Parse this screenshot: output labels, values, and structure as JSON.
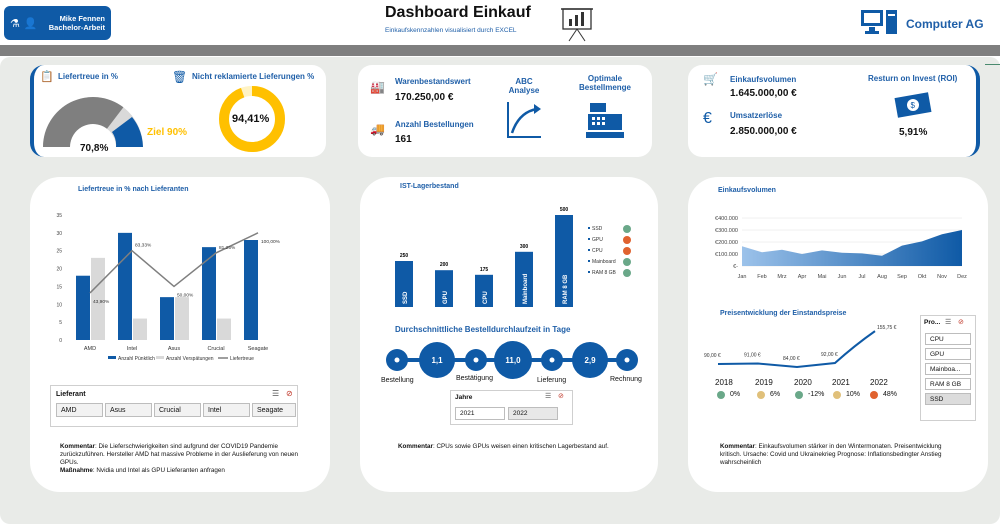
{
  "header": {
    "user_name": "Mike Fennen",
    "user_role": "Bachelor-Arbeit",
    "title": "Dashboard Einkauf",
    "subtitle": "Einkaufskennzahlen visualisiert durch EXCEL",
    "company": "Computer AG"
  },
  "kpi_left": {
    "liefertreue_label": "Liefertreue in %",
    "liefertreue_value": "70,8%",
    "liefertreue_fraction": 0.708,
    "ziel_label": "Ziel 90%",
    "reklam_label": "Nicht reklamierte Lieferungen %",
    "reklam_value": "94,41%",
    "reklam_fraction": 0.9441
  },
  "kpi_mid": {
    "lager_label": "Warenbestandswert",
    "lager_value": "170.250,00 €",
    "bestell_label": "Anzahl Bestellungen",
    "bestell_value": "161",
    "abc_label": "ABC Analyse",
    "opt_label": "Optimale Bestellmenge"
  },
  "kpi_right": {
    "volumen_label": "Einkaufsvolumen",
    "volumen_value": "1.645.000,00 €",
    "umsatz_label": "Umsatzerlöse",
    "umsatz_value": "2.850.000,00 €",
    "roi_label": "Resturn on Invest (ROI)",
    "roi_value": "5,91%"
  },
  "panel_left": {
    "title": "Liefertreue in % nach  Lieferanten",
    "slicer_title": "Lieferant",
    "slicer_items": [
      "AMD",
      "Asus",
      "Crucial",
      "Intel",
      "Seagate"
    ],
    "comment_k_label": "Kommentar",
    "comment_k": ": Die Lieferschwierigkeiten sind aufgrund der COVID19 Pandemie zurückzuführen. Hersteller AMD hat massive Probleme in der Auslieferung von neuen GPUs.",
    "comment_m_label": "Maßnahme",
    "comment_m": ": Nvidia und Intel als GPU Lieferanten anfragen"
  },
  "panel_mid": {
    "title": "IST-Lagerbestand",
    "lead_title": "Durchschnittliche Bestelldurchlaufzeit in Tage",
    "steps": [
      "Bestellung",
      "Bestätigung",
      "Lieferung",
      "Rechnung"
    ],
    "durations": [
      "1,1",
      "11,0",
      "2,9"
    ],
    "slicer_title": "Jahre",
    "slicer_items": [
      "2021",
      "2022"
    ],
    "comment_label": "Kommentar",
    "comment": ": CPUs sowie GPUs weisen einen kritischen Lagerbestand auf."
  },
  "panel_right": {
    "title": "Einkaufsvolumen",
    "price_title": "Preisentwicklung der Einstandspreise",
    "price_years": [
      "2018",
      "2019",
      "2020",
      "2021",
      "2022"
    ],
    "price_changes": [
      "0%",
      "6%",
      "-12%",
      "10%",
      "48%"
    ],
    "price_dot_colors": [
      "#6aa889",
      "#e0c07a",
      "#6aa889",
      "#e0c07a",
      "#e0622f"
    ],
    "slicer_title": "Pro...",
    "slicer_items": [
      "CPU",
      "GPU",
      "Mainboa...",
      "RAM 8 GB",
      "SSD"
    ],
    "comment_label": "Kommentar",
    "comment": ": Einkaufsvolumen stärker in den Wintermonaten. Preisentwicklung kritisch. Ursache: Covid und Ukrainekrieg Prognose: Inflationsbedingter Anstieg wahrscheinlich"
  },
  "colors": {
    "brand_blue": "#0f5aa6",
    "bar_grey": "#d9d9d9",
    "line_grey": "#7f7f7f",
    "donut_yellow": "#ffc000",
    "status_green": "#6aa889",
    "status_red": "#e0622f",
    "status_orange": "#e0c07a"
  },
  "chart_data": [
    {
      "type": "bar",
      "title": "Liefertreue in % nach  Lieferanten",
      "categories": [
        "AMD",
        "Intel",
        "Asus",
        "Crucial",
        "Seagate"
      ],
      "ylim": [
        0,
        35
      ],
      "yticks": [
        "0",
        "5",
        "10",
        "15",
        "20",
        "25",
        "30",
        "35"
      ],
      "series": [
        {
          "name": "Anzahl Pünktlich",
          "values": [
            18,
            30,
            12,
            26,
            28
          ]
        },
        {
          "name": "Anzahl Verspätungen",
          "values": [
            23,
            6,
            12,
            6,
            0
          ]
        }
      ],
      "line_series": {
        "name": "Liefertreue",
        "labels": [
          "43,90%",
          "83,33%",
          "50,00%",
          "81,25%",
          "100,00%"
        ],
        "values": [
          43.9,
          83.33,
          50.0,
          81.25,
          100.0
        ]
      },
      "legend_placement": "bottom"
    },
    {
      "type": "bar",
      "title": "IST-Lagerbestand",
      "categories": [
        "SSD",
        "GPU",
        "CPU",
        "Mainboard",
        "RAM 8 GB"
      ],
      "values": [
        250,
        200,
        175,
        300,
        500
      ],
      "value_labels": [
        "250",
        "200",
        "175",
        "300",
        "500"
      ],
      "status_colors": [
        "#6aa889",
        "#e0622f",
        "#e0622f",
        "#6aa889",
        "#6aa889"
      ],
      "legend_placement": "right"
    },
    {
      "type": "area",
      "title": "Einkaufsvolumen",
      "categories": [
        "Jan",
        "Feb",
        "Mrz",
        "Apr",
        "Mai",
        "Jun",
        "Jul",
        "Aug",
        "Sep",
        "Okt",
        "Nov",
        "Dez"
      ],
      "values": [
        165000,
        115000,
        135000,
        100000,
        130000,
        110000,
        105000,
        85000,
        170000,
        205000,
        265000,
        300000
      ],
      "yticks": [
        "€-",
        "€100.000",
        "€200.000",
        "€300.000",
        "€400.000"
      ],
      "ylim": [
        0,
        400000
      ],
      "grid": true
    },
    {
      "type": "line",
      "title": "Preisentwicklung der Einstandspreise",
      "categories": [
        "2018",
        "2019",
        "2020",
        "2021",
        "2022"
      ],
      "values": [
        90.0,
        91.0,
        84.0,
        92.0,
        155.75
      ],
      "value_labels": [
        "90,00 €",
        "91,00 €",
        "84,00 €",
        "92,00 €",
        "155,75 €"
      ]
    }
  ]
}
